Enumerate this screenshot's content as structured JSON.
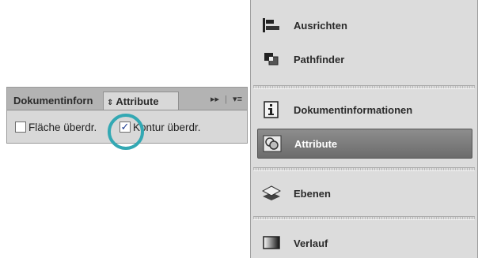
{
  "attribute_panel": {
    "tabs": [
      {
        "label": "Dokumentinforn"
      },
      {
        "label": "Attribute",
        "indicator": "⇕"
      }
    ],
    "tab_buttons": {
      "collapse": "▸▸",
      "menu": "▾≡"
    },
    "checkboxes": [
      {
        "label": "Fläche überdr.",
        "checked": false
      },
      {
        "label": "Kontur überdr.",
        "checked": true,
        "check_glyph": "✓"
      }
    ],
    "highlight_color": "#33a8b3"
  },
  "panel_list": {
    "items": [
      {
        "label": "Ausrichten",
        "icon": "align-icon",
        "selected": false
      },
      {
        "label": "Pathfinder",
        "icon": "pathfinder-icon",
        "selected": false
      },
      {
        "label": "Dokumentinformationen",
        "icon": "info-icon",
        "selected": false
      },
      {
        "label": "Attribute",
        "icon": "attribute-icon",
        "selected": true
      },
      {
        "label": "Ebenen",
        "icon": "layers-icon",
        "selected": false
      },
      {
        "label": "Verlauf",
        "icon": "gradient-icon",
        "selected": false
      }
    ],
    "selected_color": "#7a7a7a"
  }
}
